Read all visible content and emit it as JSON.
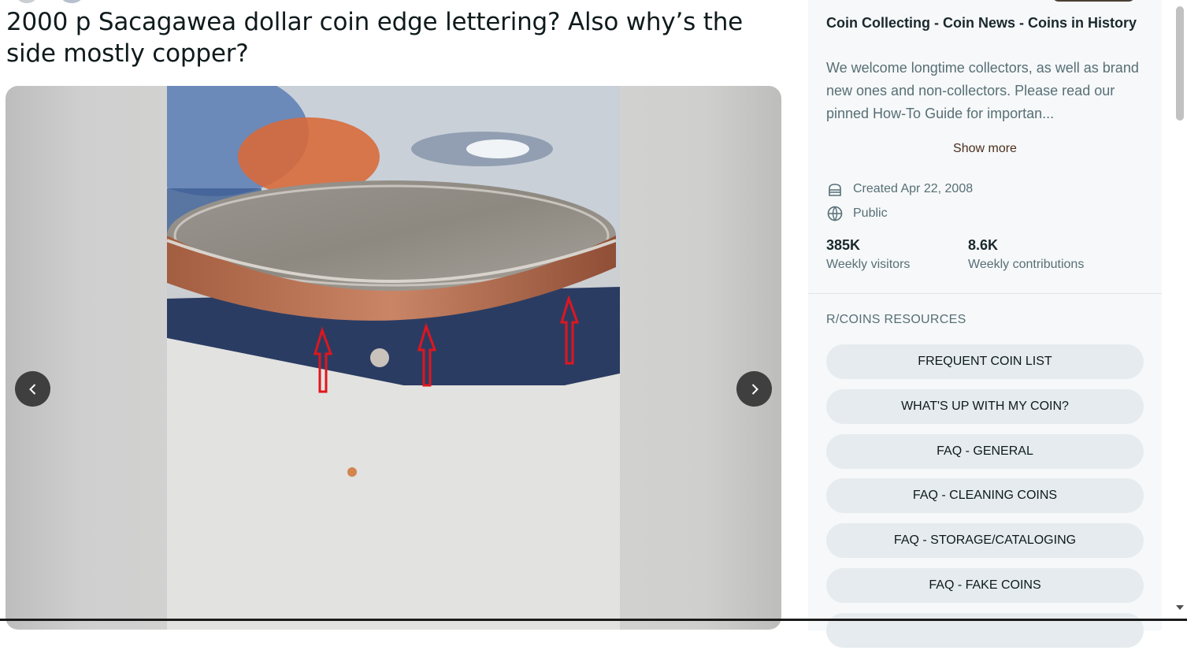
{
  "post": {
    "title": "2000 p Sacagawea dollar coin edge lettering? Also why’s the side mostly copper?"
  },
  "gallery": {
    "image_description_icon": "coin-photo",
    "prev_icon": "chevron-left-icon",
    "next_icon": "chevron-right-icon"
  },
  "sidebar": {
    "community_title": "Coin Collecting - Coin News - Coins in History",
    "description": "We welcome longtime collectors, as well as brand new ones and non-collectors. Please read our pinned How-To Guide for importan...",
    "show_more": "Show more",
    "created": "Created Apr 22, 2008",
    "visibility": "Public",
    "stats": [
      {
        "value": "385K",
        "label": "Weekly visitors"
      },
      {
        "value": "8.6K",
        "label": "Weekly contributions"
      }
    ],
    "resources_heading": "R/COINS RESOURCES",
    "resources": [
      "FREQUENT COIN LIST",
      "WHAT'S UP WITH MY COIN?",
      "FAQ - GENERAL",
      "FAQ - CLEANING COINS",
      "FAQ - STORAGE/CATALOGING",
      "FAQ - FAKE COINS"
    ]
  },
  "colors": {
    "nav_button": "#3f3f3f",
    "resource_button": "#e5ebee",
    "arrow_annotation": "#e0161e"
  }
}
